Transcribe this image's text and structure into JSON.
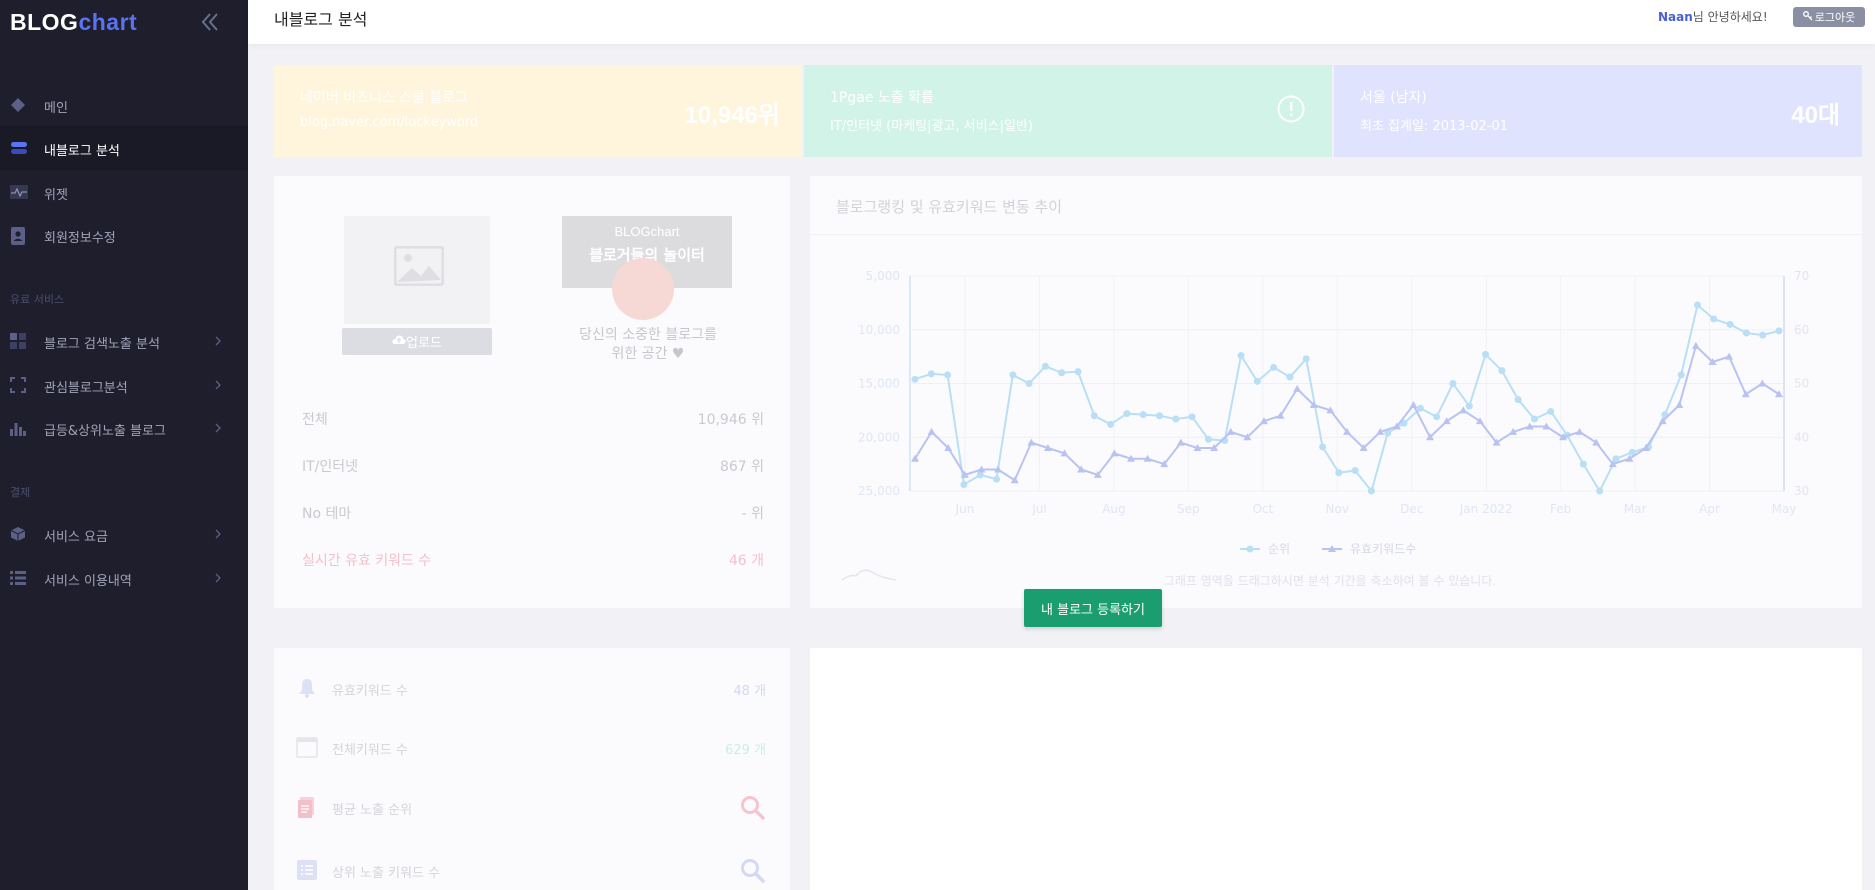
{
  "sidebar": {
    "logo_part1": "BLOG",
    "logo_part2": "chart",
    "items": [
      {
        "label": "메인"
      },
      {
        "label": "내블로그 분석"
      },
      {
        "label": "위젯"
      },
      {
        "label": "회원정보수정"
      }
    ],
    "section_paid": "유료 서비스",
    "paid_items": [
      {
        "label": "블로그 검색노출 분석"
      },
      {
        "label": "관심블로그분석"
      },
      {
        "label": "급등&상위노출 블로그"
      }
    ],
    "section_payment": "결제",
    "payment_items": [
      {
        "label": "서비스 요금"
      },
      {
        "label": "서비스 이용내역"
      }
    ]
  },
  "header": {
    "title": "내블로그 분석",
    "user_name": "Naan",
    "greeting_suffix": "님 안녕하세요!",
    "logout_label": "로그아웃"
  },
  "cards": [
    {
      "line1": "네이버 비즈니스 스쿨 블로그",
      "line2": "blog.naver.com/luckeyword",
      "value": "10,946위"
    },
    {
      "line1": "1Pgae 노출 확률",
      "line2": "IT/인터넷 (마케팅|광고, 서비스|일반)",
      "value": ""
    },
    {
      "line1": "서울 (남자)",
      "line2": "최초 집계일: 2013-02-01",
      "value": "40대"
    }
  ],
  "profile": {
    "upload_label": "업로드",
    "promo_brand": "BLOGchart",
    "promo_tagline": "블로거들의 놀이터",
    "promo_text_1": "당신의 소중한 블로그를",
    "promo_text_2": "위한 공간 ♥",
    "stats": [
      {
        "label": "전체",
        "value": "10,946 위"
      },
      {
        "label": "IT/인터넷",
        "value": "867 위"
      },
      {
        "label": "No 테마",
        "value": "- 위"
      },
      {
        "label": "실시간 유효 키워드 수",
        "value": "46 개"
      }
    ]
  },
  "chart": {
    "title": "블로그랭킹 및 유효키워드 변동 추이",
    "legend_rank": "순위",
    "legend_keywords": "유효키워드수",
    "hint": "그래프 영역을 드래그하시면 분석 기간을 축소하여 볼 수 있습니다."
  },
  "register_button": "내 블로그 등록하기",
  "bottom_stats": [
    {
      "label": "유효키워드 수",
      "value": "48 개"
    },
    {
      "label": "전체키워드 수",
      "value": "629 개"
    },
    {
      "label": "평균 노출 순위",
      "value": ""
    },
    {
      "label": "상위 노출 키워드 수",
      "value": ""
    }
  ],
  "chart_data": {
    "type": "line",
    "title": "블로그랭킹 및 유효키워드 변동 추이",
    "x_ticks": [
      "Jun",
      "Jul",
      "Aug",
      "Sep",
      "Oct",
      "Nov",
      "Dec",
      "Jan 2022",
      "Feb",
      "Mar",
      "Apr",
      "May"
    ],
    "y_left_ticks": [
      "5,000",
      "10,000",
      "15,000",
      "20,000",
      "25,000"
    ],
    "y_left_range": [
      5000,
      25000
    ],
    "y_left_inverted": true,
    "y_right_ticks": [
      "70",
      "60",
      "50",
      "40",
      "30"
    ],
    "y_right_range": [
      30,
      70
    ],
    "series": [
      {
        "name": "순위",
        "axis": "left",
        "color": "#b8dff5",
        "values": [
          14600,
          14100,
          14200,
          24400,
          23500,
          23900,
          14200,
          15000,
          13400,
          14000,
          13900,
          18000,
          18800,
          17800,
          17900,
          18000,
          18300,
          18100,
          20200,
          20300,
          12400,
          14800,
          13500,
          14400,
          12700,
          20900,
          23300,
          23100,
          25000,
          19600,
          18700,
          17300,
          18100,
          15000,
          17100,
          12300,
          13800,
          16500,
          18300,
          17600,
          19800,
          22500,
          25000,
          22000,
          21400,
          20900,
          17900,
          14200,
          7700,
          9000,
          9500,
          10300,
          10500,
          10100
        ]
      },
      {
        "name": "유효키워드수",
        "axis": "right",
        "color": "#b9c3f2",
        "values": [
          36,
          41,
          38,
          33,
          34,
          34,
          32,
          39,
          38,
          37,
          34,
          33,
          37,
          36,
          36,
          35,
          39,
          38,
          38,
          41,
          40,
          43,
          44,
          49,
          46,
          45,
          41,
          38,
          41,
          42,
          46,
          40,
          43,
          45,
          43,
          39,
          41,
          42,
          42,
          40,
          41,
          39,
          35,
          36,
          38,
          43,
          46,
          57,
          54,
          55,
          48,
          50,
          48
        ]
      }
    ],
    "legend": "bottom-center",
    "grid": true
  }
}
